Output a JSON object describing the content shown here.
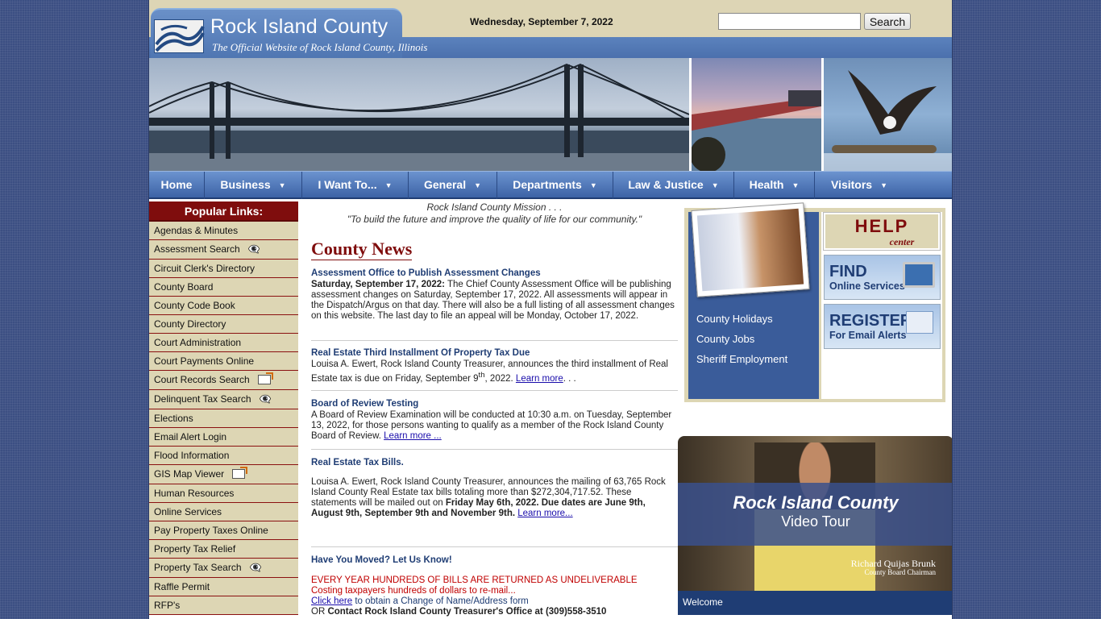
{
  "header": {
    "title": "Rock Island County",
    "subtitle": "The Official Website of Rock Island County, Illinois",
    "date": "Wednesday, September 7, 2022",
    "search_placeholder": "",
    "search_button": "Search"
  },
  "nav": {
    "items": [
      {
        "label": "Home"
      },
      {
        "label": "Business"
      },
      {
        "label": "I Want To..."
      },
      {
        "label": "General"
      },
      {
        "label": "Departments"
      },
      {
        "label": "Law & Justice"
      },
      {
        "label": "Health"
      },
      {
        "label": "Visitors"
      }
    ]
  },
  "sidebar": {
    "heading": "Popular Links:",
    "items": [
      "Agendas & Minutes",
      "Assessment Search",
      "Circuit Clerk's Directory",
      "County Board",
      "County Code Book",
      "County Directory",
      "Court Administration",
      "Court Payments Online",
      "Court Records Search",
      "Delinquent Tax Search",
      "Elections",
      "Email Alert Login",
      "Flood Information",
      "GIS Map Viewer",
      "Human Resources",
      "Online Services",
      "Pay Property Taxes Online",
      "Property Tax Relief",
      "Property Tax Search",
      "Raffle Permit",
      "RFP's"
    ]
  },
  "mission": {
    "line1": "Rock Island County Mission . . .",
    "line2": "\"To build the future and improve the quality of life for our community.\""
  },
  "news": {
    "title": "County News",
    "items": [
      {
        "headline": "Assessment Office to Publish Assessment Changes",
        "lead": "Saturday, September 17, 2022:",
        "body": " The Chief County Assessment Office will be publishing assessment changes on Saturday, September 17, 2022. All assessments will appear in the Dispatch/Argus on that day. There will also be a full listing of all assessment changes on this website. The last day to file an appeal will be Monday, October 17, 2022."
      },
      {
        "headline": "Real Estate Third Installment Of Property Tax Due",
        "body1": "Louisa A. Ewert, Rock Island County Treasurer, announces the third installment of Real Estate tax is due on Friday,  September 9",
        "sup": "th",
        "body2": ", 2022. ",
        "link": "Learn more",
        "tail": ". . ."
      },
      {
        "headline": "Board of Review Testing",
        "body": "A Board of Review Examination will be conducted at 10:30 a.m. on Tuesday, September 13, 2022, for those persons wanting to qualify as a member of the Rock Island County Board of Review. ",
        "link": "Learn more ..."
      },
      {
        "headline": "Real Estate Tax Bills.",
        "body": "Louisa A. Ewert, Rock Island County Treasurer, announces the mailing of 63,765 Rock Island County Real Estate tax bills totaling more than $272,304,717.52. These statements will be mailed out on ",
        "bold1": "Friday May 6th, 2022.  Due dates are June 9th, August 9th, September 9th and November 9th.",
        "link": "Learn more..."
      },
      {
        "headline": "Have You Moved? Let Us Know!",
        "red1": "EVERY YEAR HUNDREDS OF BILLS ARE RETURNED AS UNDELIVERABLE",
        "red2": "Costing taxpayers hundreds of dollars to re-mail...",
        "link": "Click here",
        "link_tail": " to obtain a Change of Name/Address form",
        "or": "OR ",
        "contact": "Contact Rock Island County Treasurer's Office at (309)558-3510"
      }
    ]
  },
  "right_panel": {
    "links": [
      "County Holidays",
      "County Jobs",
      "Sheriff Employment"
    ],
    "help_big": "HELP",
    "help_small": "center",
    "find_big": "FIND",
    "find_small": "Online Services",
    "register_big": "REGISTER",
    "register_small": "For Email Alerts"
  },
  "video": {
    "title": "Rock Island County",
    "subtitle": "Video Tour",
    "person_name": "Richard Quijas Brunk",
    "person_role": "County Board Chairman",
    "welcome": "Welcome"
  },
  "colors": {
    "accent_blue": "#4b70ad",
    "maroon": "#7f0d0d",
    "tan": "#ddd6b4"
  }
}
